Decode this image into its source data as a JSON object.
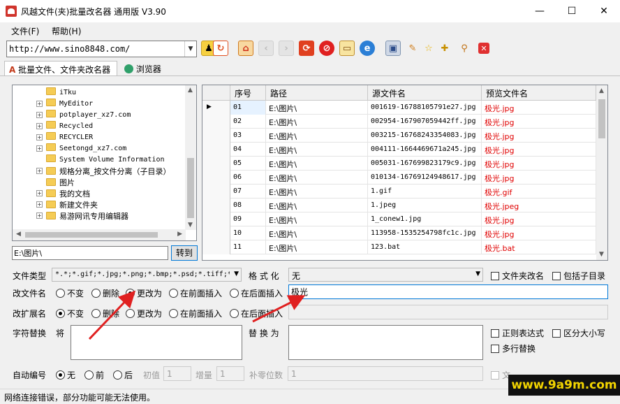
{
  "window": {
    "title": "风越文件(夹)批量改名器 通用版 V3.90",
    "minimize": "—",
    "maximize": "☐",
    "close": "✕"
  },
  "menu": [
    "文件(F)",
    "帮助(H)"
  ],
  "toolbar": {
    "url": "http://www.sino8848.com/"
  },
  "tabs": [
    "批量文件、文件夹改名器",
    "浏览器"
  ],
  "tree": {
    "items": [
      {
        "label": "iTku",
        "mono": true,
        "expander": false
      },
      {
        "label": "MyEditor",
        "mono": true,
        "expander": true
      },
      {
        "label": "potplayer_xz7.com",
        "mono": true,
        "expander": true
      },
      {
        "label": "Recycled",
        "mono": true,
        "expander": true
      },
      {
        "label": "RECYCLER",
        "mono": true,
        "expander": true
      },
      {
        "label": "Seetongd_xz7.com",
        "mono": true,
        "expander": true
      },
      {
        "label": "System Volume Information",
        "mono": true,
        "expander": false
      },
      {
        "label": "规格分离_按文件分离（子目录）",
        "mono": false,
        "expander": true
      },
      {
        "label": "图片",
        "mono": false,
        "expander": false
      },
      {
        "label": "我的文档",
        "mono": false,
        "expander": true
      },
      {
        "label": "新建文件夹",
        "mono": false,
        "expander": true
      },
      {
        "label": "易游网讯专用编辑器",
        "mono": false,
        "expander": true
      }
    ]
  },
  "path": {
    "value": "E:\\图片\\",
    "go_label": "转到"
  },
  "grid": {
    "headers": [
      "序号",
      "路径",
      "源文件名",
      "预览文件名"
    ],
    "rows": [
      {
        "no": "01",
        "path": "E:\\图片\\",
        "src": "001619-16788105791e27.jpg",
        "preview": "极光.jpg"
      },
      {
        "no": "02",
        "path": "E:\\图片\\",
        "src": "002954-167907059442ff.jpg",
        "preview": "极光.jpg"
      },
      {
        "no": "03",
        "path": "E:\\图片\\",
        "src": "003215-16768243354083.jpg",
        "preview": "极光.jpg"
      },
      {
        "no": "04",
        "path": "E:\\图片\\",
        "src": "004111-1664469671a245.jpg",
        "preview": "极光.jpg"
      },
      {
        "no": "05",
        "path": "E:\\图片\\",
        "src": "005031-1676998231​79c9.jpg",
        "preview": "极光.jpg"
      },
      {
        "no": "06",
        "path": "E:\\图片\\",
        "src": "010134-16769124948617.jpg",
        "preview": "极光.jpg"
      },
      {
        "no": "07",
        "path": "E:\\图片\\",
        "src": "1.gif",
        "preview": "极光.gif"
      },
      {
        "no": "08",
        "path": "E:\\图片\\",
        "src": "1.jpeg",
        "preview": "极光.jpeg"
      },
      {
        "no": "09",
        "path": "E:\\图片\\",
        "src": "1_conew1.jpg",
        "preview": "极光.jpg"
      },
      {
        "no": "10",
        "path": "E:\\图片\\",
        "src": "113958-1535254798fc1c.jpg",
        "preview": "极光.jpg"
      },
      {
        "no": "11",
        "path": "E:\\图片\\",
        "src": "123.bat",
        "preview": "极光.bat"
      }
    ]
  },
  "options": {
    "filetype_label": "文件类型",
    "filetype_value": "*.*;*.gif;*.jpg;*.png;*.bmp;*.psd;*.tiff;*",
    "format_label": "格 式 化",
    "format_value": "无",
    "folder_rename": "文件夹改名",
    "include_sub": "包括子目录",
    "rename_label": "改文件名",
    "ext_label": "改扩展名",
    "radio_unchanged": "不变",
    "radio_delete": "删除",
    "radio_change": "更改为",
    "radio_prefix": "在前面插入",
    "radio_suffix": "在后面插入",
    "rename_value": "极光",
    "replace_label": "字符替换",
    "replace_from": "将",
    "replace_to": "替 换 为",
    "regex": "正则表达式",
    "case": "区分大小写",
    "multiline": "多行替换",
    "auto_label": "自动编号",
    "auto_none": "无",
    "auto_front": "前",
    "auto_back": "后",
    "init_label": "初值",
    "init_value": "1",
    "inc_label": "增量",
    "inc_value": "1",
    "pad_label": "补零位数",
    "pad_value": "1",
    "cut_label": "文"
  },
  "status": {
    "text": "网络连接错误，部分功能可能无法使用。"
  },
  "watermark": "www.9a9m.com"
}
